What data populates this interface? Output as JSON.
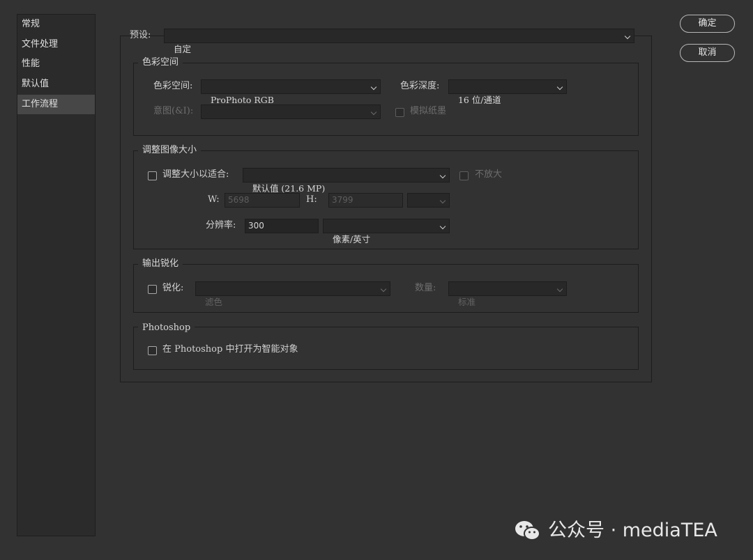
{
  "sidebar": {
    "items": [
      {
        "label": "常规"
      },
      {
        "label": "文件处理"
      },
      {
        "label": "性能"
      },
      {
        "label": "默认值"
      },
      {
        "label": "工作流程",
        "active": true
      }
    ]
  },
  "buttons": {
    "ok": "确定",
    "cancel": "取消"
  },
  "preset": {
    "label": "预设:",
    "value": "自定"
  },
  "color_space_group": {
    "title": "色彩空间",
    "color_space_label": "色彩空间:",
    "color_space_value": "ProPhoto RGB",
    "bit_depth_label": "色彩深度:",
    "bit_depth_value": "16 位/通道",
    "intent_label": "意图(&I):",
    "intent_value": "",
    "simulate_paper_label": "模拟纸墨",
    "simulate_paper_checked": false
  },
  "resize_group": {
    "title": "调整图像大小",
    "fit_label": "调整大小以适合:",
    "fit_checked": false,
    "fit_value": "默认值 (21.6 MP)",
    "no_enlarge_label": "不放大",
    "no_enlarge_checked": false,
    "w_label": "W:",
    "w_value": "5698",
    "h_label": "H:",
    "h_value": "3799",
    "unit_value": "",
    "resolution_label": "分辨率:",
    "resolution_value": "300",
    "resolution_unit": "像素/英寸"
  },
  "sharpen_group": {
    "title": "输出锐化",
    "sharpen_label": "锐化:",
    "sharpen_checked": false,
    "sharpen_value": "滤色",
    "amount_label": "数量:",
    "amount_value": "标准"
  },
  "photoshop_group": {
    "title": "Photoshop",
    "smart_object_label": "在 Photoshop 中打开为智能对象",
    "smart_object_checked": false
  },
  "watermark": {
    "text": "公众号 · mediaTEA",
    "icon": "wechat-icon"
  },
  "colors": {
    "background": "#323232",
    "sidebar_active": "#474747",
    "border": "#1c1c1c"
  }
}
